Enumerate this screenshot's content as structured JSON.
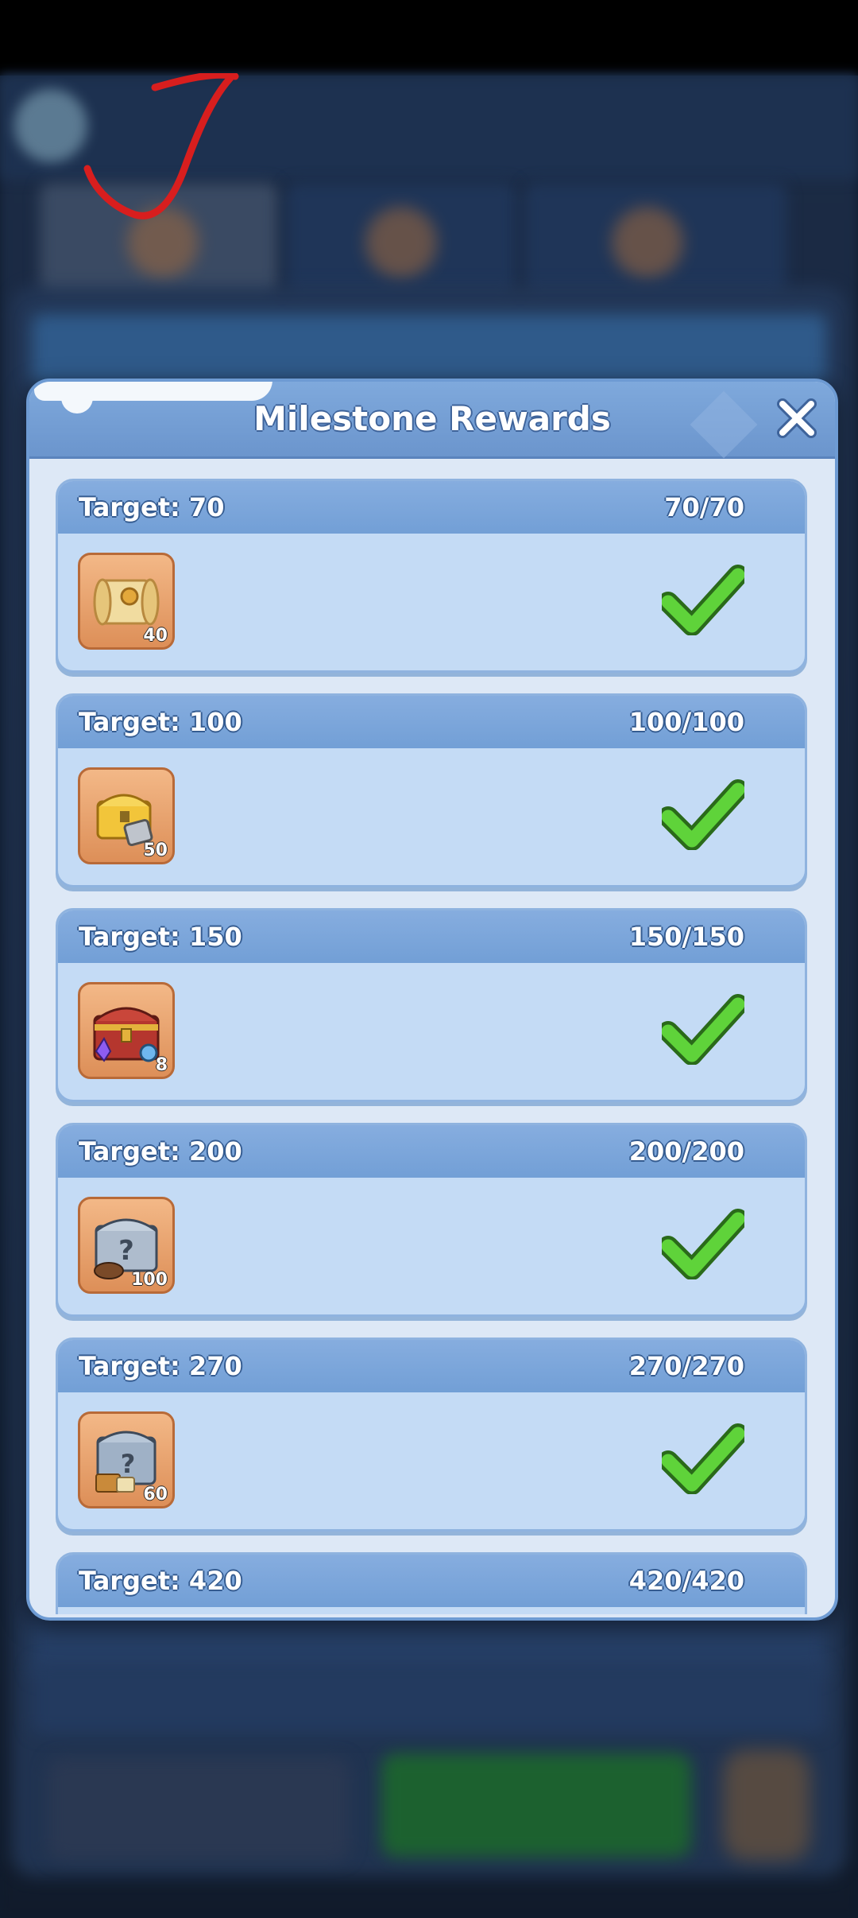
{
  "dialog": {
    "title": "Milestone Rewards",
    "close_icon": "close-icon"
  },
  "milestones": [
    {
      "target": "Target: 70",
      "progress": "70/70",
      "reward_icon": "scroll-icon",
      "reward_count": "40",
      "claimed": true
    },
    {
      "target": "Target: 100",
      "progress": "100/100",
      "reward_icon": "gold-chest-icon",
      "reward_count": "50",
      "claimed": true
    },
    {
      "target": "Target: 150",
      "progress": "150/150",
      "reward_icon": "treasure-chest-icon",
      "reward_count": "8",
      "claimed": true
    },
    {
      "target": "Target: 200",
      "progress": "200/200",
      "reward_icon": "mystery-chest-icon",
      "reward_count": "100",
      "claimed": true
    },
    {
      "target": "Target: 270",
      "progress": "270/270",
      "reward_icon": "mystery-crate-icon",
      "reward_count": "60",
      "claimed": true
    },
    {
      "target": "Target: 420",
      "progress": "420/420",
      "reward_icon": "",
      "reward_count": "",
      "claimed": true
    }
  ],
  "colors": {
    "header_blue": "#7fa9dc",
    "card_blue": "#c4dbf5",
    "check_green": "#5fd33a",
    "item_orange": "#e9a06b"
  }
}
